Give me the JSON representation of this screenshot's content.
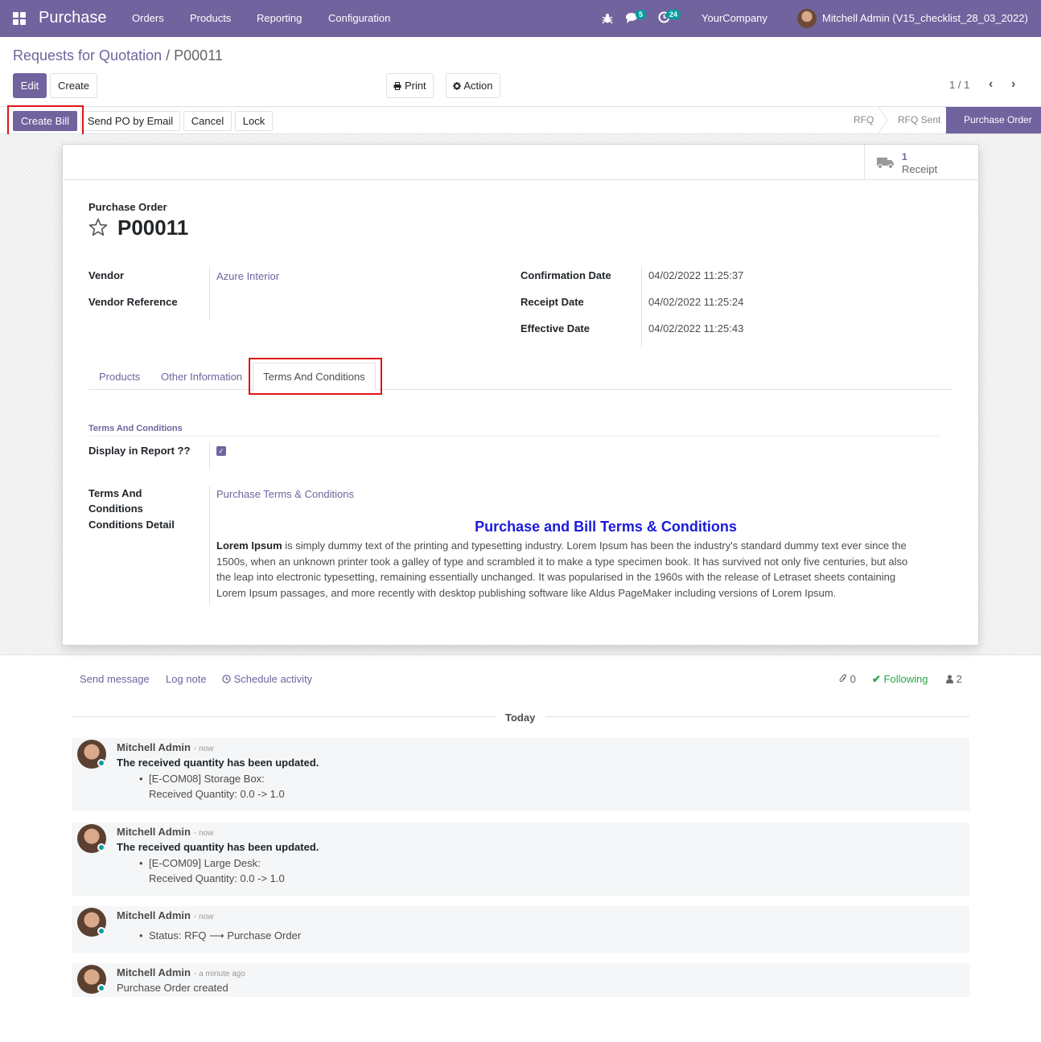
{
  "navbar": {
    "app_name": "Purchase",
    "menus": [
      "Orders",
      "Products",
      "Reporting",
      "Configuration"
    ],
    "messages_count": "5",
    "activities_count": "24",
    "company": "YourCompany",
    "user": "Mitchell Admin (V15_checklist_28_03_2022)"
  },
  "breadcrumb": {
    "parent": "Requests for Quotation",
    "separator": "/",
    "current": "P00011"
  },
  "control": {
    "edit": "Edit",
    "create": "Create",
    "print": "Print",
    "action": "Action",
    "pager": "1 / 1"
  },
  "statusbar": {
    "buttons": [
      "Create Bill",
      "Send PO by Email",
      "Cancel",
      "Lock"
    ],
    "stages": [
      "RFQ",
      "RFQ Sent",
      "Purchase Order"
    ],
    "active_stage": "Purchase Order"
  },
  "smart_button": {
    "count": "1",
    "label": "Receipt"
  },
  "form": {
    "title_label": "Purchase Order",
    "name": "P00011",
    "vendor_label": "Vendor",
    "vendor": "Azure Interior",
    "vendor_ref_label": "Vendor Reference",
    "vendor_ref": "",
    "confirmation_date_label": "Confirmation Date",
    "confirmation_date": "04/02/2022 11:25:37",
    "receipt_date_label": "Receipt Date",
    "receipt_date": "04/02/2022 11:25:24",
    "effective_date_label": "Effective Date",
    "effective_date": "04/02/2022 11:25:43"
  },
  "tabs": [
    "Products",
    "Other Information",
    "Terms And Conditions"
  ],
  "terms": {
    "section_title": "Terms And Conditions",
    "display_label": "Display in Report ??",
    "display_checked": true,
    "tc_label_line1": "Terms And",
    "tc_label_line2": "Conditions",
    "tc_label_line3": "Conditions Detail",
    "tc_value": "Purchase Terms & Conditions",
    "heading": "Purchase and Bill Terms & Conditions",
    "body_bold": "Lorem Ipsum",
    "body": " is simply dummy text of the printing and typesetting industry. Lorem Ipsum has been the industry's standard dummy text ever since the 1500s, when an unknown printer took a galley of type and scrambled it to make a type specimen book. It has survived not only five centuries, but also the leap into electronic typesetting, remaining essentially unchanged. It was popularised in the 1960s with the release of Letraset sheets containing Lorem Ipsum passages, and more recently with desktop publishing software like Aldus PageMaker including versions of Lorem Ipsum."
  },
  "chatter": {
    "send_message": "Send message",
    "log_note": "Log note",
    "schedule_activity": "Schedule activity",
    "attachments": "0",
    "following": "Following",
    "followers": "2",
    "today": "Today",
    "messages": [
      {
        "author": "Mitchell Admin",
        "when": "- now",
        "text": "The received quantity has been updated.",
        "item": "[E-COM08] Storage Box:",
        "detail": "Received Quantity: 0.0 -> 1.0"
      },
      {
        "author": "Mitchell Admin",
        "when": "- now",
        "text": "The received quantity has been updated.",
        "item": "[E-COM09] Large Desk:",
        "detail": "Received Quantity: 0.0 -> 1.0"
      },
      {
        "author": "Mitchell Admin",
        "when": "- now",
        "status_prefix": "Status: RFQ ",
        "status_arrow": "⟶",
        "status_suffix": " Purchase Order"
      },
      {
        "author": "Mitchell Admin",
        "when": "- a minute ago",
        "text": "Purchase Order created"
      }
    ]
  },
  "colors": {
    "brand": "#71639e",
    "accent": "#00a09d",
    "highlight_box": "#e01414",
    "tc_heading": "#1a1adc"
  }
}
